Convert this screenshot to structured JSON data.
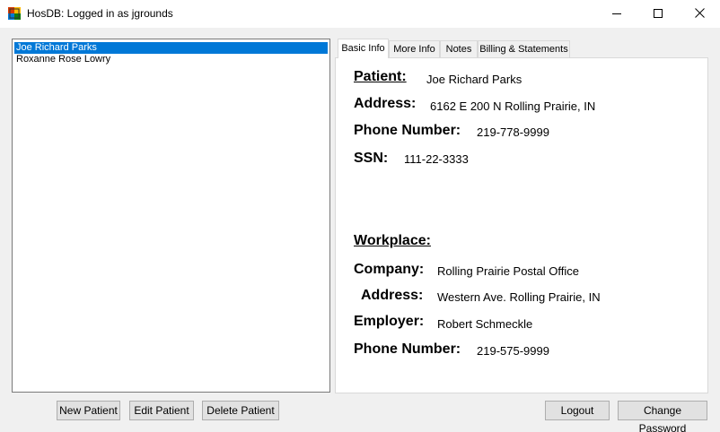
{
  "window": {
    "title": "HosDB: Logged in as jgrounds",
    "icon": "app-icon",
    "controls": [
      "minimize-icon",
      "maximize-icon",
      "close-icon"
    ]
  },
  "patients": [
    {
      "name": "Joe Richard Parks",
      "selected": true
    },
    {
      "name": "Roxanne Rose Lowry",
      "selected": false
    }
  ],
  "tabs": [
    {
      "label": "Basic Info",
      "active": true
    },
    {
      "label": "More Info",
      "active": false
    },
    {
      "label": "Notes",
      "active": false
    },
    {
      "label": "Billing & Statements",
      "active": false
    }
  ],
  "basic_info": {
    "patient_label": "Patient:",
    "patient_value": "Joe Richard Parks",
    "address_label": "Address:",
    "address_value": "6162 E 200 N Rolling Prairie, IN",
    "phone_label": "Phone Number:",
    "phone_value": "219-778-9999",
    "ssn_label": "SSN:",
    "ssn_value": "111-22-3333",
    "workplace_heading": "Workplace:",
    "company_label": "Company:",
    "company_value": "Rolling Prairie Postal Office",
    "work_address_label": "Address:",
    "work_address_value": "Western Ave. Rolling Prairie, IN",
    "employer_label": "Employer:",
    "employer_value": "Robert Schmeckle",
    "work_phone_label": "Phone Number:",
    "work_phone_value": "219-575-9999"
  },
  "buttons": {
    "new_patient": "New Patient",
    "edit_patient": "Edit Patient",
    "delete_patient": "Delete Patient",
    "logout": "Logout",
    "change_password": "Change Password"
  },
  "colors": {
    "selection": "#0078d7",
    "window_bg": "#f0f0f0",
    "button_bg": "#e1e1e1"
  }
}
